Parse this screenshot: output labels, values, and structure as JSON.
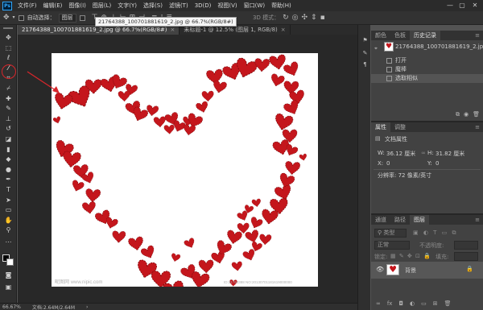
{
  "app": {
    "logo": "Ps",
    "menus": [
      "文件(F)",
      "编辑(E)",
      "图像(I)",
      "图层(L)",
      "文字(Y)",
      "选择(S)",
      "滤镜(T)",
      "3D(D)",
      "视图(V)",
      "窗口(W)",
      "帮助(H)"
    ],
    "window": {
      "minimize": "—",
      "maximize": "▢",
      "close": "✕"
    }
  },
  "options": {
    "auto_select": "自动选择：",
    "layer_dropdown": "图层",
    "mode_3d": "3D 模式："
  },
  "tabs": [
    {
      "label": "21764388_100701881619_2.jpg @ 66.7%(RGB/8#)",
      "close": "×"
    },
    {
      "label": "未标题-1 @ 12.5% (图层 1, RGB/8)",
      "close": "×"
    }
  ],
  "tooltip": "21764388_100701881619_2.jpg @ 66.7%(RGB/8#)",
  "tools": [
    {
      "icon": "move-tool-icon",
      "glyph": "✥"
    },
    {
      "icon": "marquee-tool-icon",
      "glyph": "⬚"
    },
    {
      "icon": "lasso-tool-icon",
      "glyph": "ℓ"
    },
    {
      "icon": "magic-wand-tool-icon",
      "glyph": "⁄"
    },
    {
      "icon": "crop-tool-icon",
      "glyph": "⌗"
    },
    {
      "icon": "eyedropper-tool-icon",
      "glyph": "⌿"
    },
    {
      "icon": "healing-brush-tool-icon",
      "glyph": "✚"
    },
    {
      "icon": "brush-tool-icon",
      "glyph": "✎"
    },
    {
      "icon": "clone-stamp-tool-icon",
      "glyph": "⊥"
    },
    {
      "icon": "history-brush-tool-icon",
      "glyph": "↺"
    },
    {
      "icon": "eraser-tool-icon",
      "glyph": "◪"
    },
    {
      "icon": "gradient-tool-icon",
      "glyph": "▮"
    },
    {
      "icon": "blur-tool-icon",
      "glyph": "◆"
    },
    {
      "icon": "dodge-tool-icon",
      "glyph": "●"
    },
    {
      "icon": "pen-tool-icon",
      "glyph": "✒"
    },
    {
      "icon": "type-tool-icon",
      "glyph": "T"
    },
    {
      "icon": "path-select-tool-icon",
      "glyph": "➤"
    },
    {
      "icon": "rectangle-tool-icon",
      "glyph": "▭"
    },
    {
      "icon": "hand-tool-icon",
      "glyph": "✋"
    },
    {
      "icon": "zoom-tool-icon",
      "glyph": "⚲"
    },
    {
      "icon": "more-tools-icon",
      "glyph": "…"
    }
  ],
  "status": {
    "zoom": "66.67%",
    "doc": "文档:2.64M/2.64M",
    "arrow": "›"
  },
  "history_panel": {
    "tabs": [
      "颜色",
      "色板",
      "历史记录"
    ],
    "snapshot": "21764388_100701881619_2.jpg",
    "items": [
      "打开",
      "魔棒",
      "选取相似"
    ],
    "menu": "≡"
  },
  "properties_panel": {
    "tabs": [
      "属性",
      "调整"
    ],
    "title": "文档属性",
    "w_label": "W:",
    "w_value": "36.12 厘米",
    "h_label": "H:",
    "h_value": "31.82 厘米",
    "x_label": "X:",
    "x_value": "0",
    "y_label": "Y:",
    "y_value": "0",
    "resolution": "分辨率: 72 像素/英寸"
  },
  "layers_panel": {
    "tabs": [
      "通道",
      "路径",
      "图层"
    ],
    "kind": "类型",
    "blend": "正常",
    "opacity_label": "不透明度:",
    "lock_label": "锁定:",
    "fill_label": "填充:",
    "layer_name": "背景"
  },
  "watermark_left": "昵图网 www.nipic.com",
  "watermark_right": "ID:21764388 NO:20130701181619000000"
}
